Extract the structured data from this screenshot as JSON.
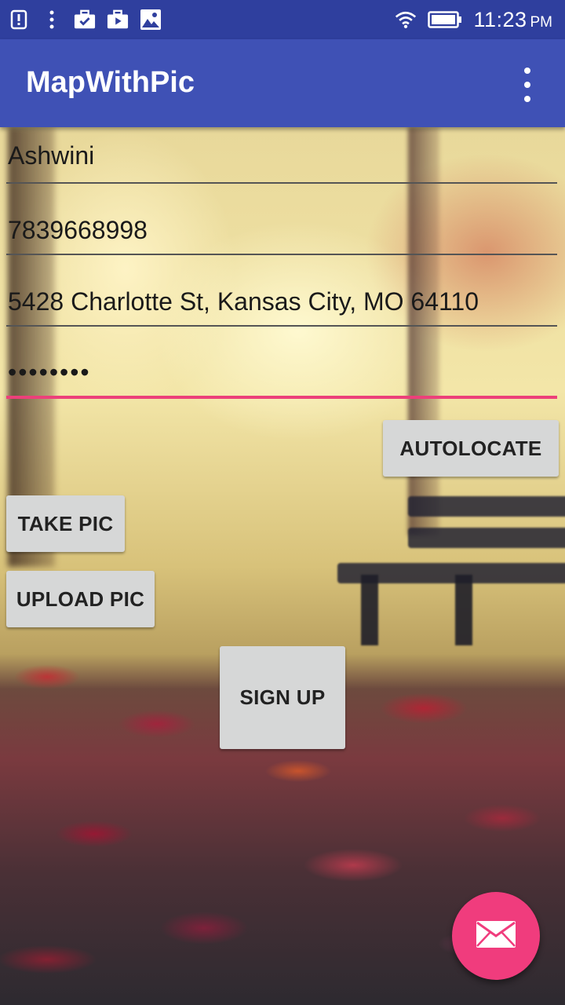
{
  "status_bar": {
    "time": "11:23",
    "ampm": "PM",
    "icons": [
      "alert-icon",
      "more-vert-icon",
      "briefcase-check-icon",
      "play-store-icon",
      "image-icon",
      "wifi-icon",
      "battery-icon"
    ]
  },
  "app_bar": {
    "title": "MapWithPic",
    "menu_icon": "overflow-menu-icon"
  },
  "form": {
    "name_value": "Ashwini",
    "phone_value": "7839668998",
    "address_value": "5428 Charlotte St, Kansas City, MO 64110",
    "password_value": "••••••••"
  },
  "buttons": {
    "autolocate": "AUTOLOCATE",
    "take_pic": "TAKE PIC",
    "upload_pic": "UPLOAD PIC",
    "sign_up": "SIGN UP"
  },
  "fab": {
    "icon": "email-icon"
  },
  "colors": {
    "status_bar": "#2f3f9e",
    "app_bar": "#3f51b5",
    "accent": "#ec407a",
    "fab": "#f03c7d",
    "button": "#d6d7d7"
  }
}
